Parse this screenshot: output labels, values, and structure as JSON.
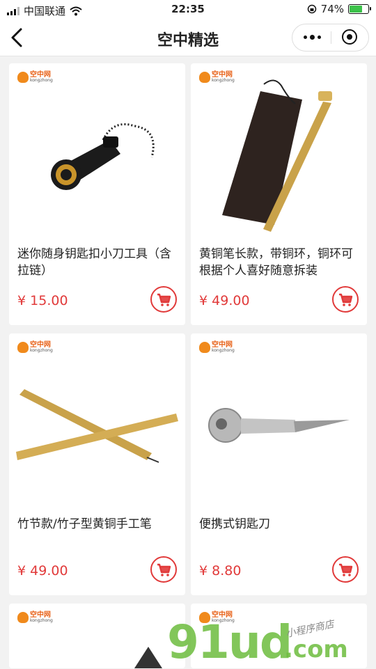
{
  "status_bar": {
    "carrier": "中国联通",
    "time": "22:35",
    "battery": "74%",
    "battery_level": 0.74
  },
  "nav": {
    "title": "空中精选"
  },
  "brand": {
    "cn": "空中网",
    "en": "kongzhong"
  },
  "currency": "¥",
  "products": [
    {
      "name": "迷你随身钥匙扣小刀工具（含拉链）",
      "price": "15.00",
      "image": "keychain-knife"
    },
    {
      "name": "黄铜笔长款，带铜环，铜环可根据个人喜好随意拆装",
      "price": "49.00",
      "image": "brass-pen-pouch"
    },
    {
      "name": "竹节款/竹子型黄铜手工笔",
      "price": "49.00",
      "image": "bamboo-brass-pens"
    },
    {
      "name": "便携式钥匙刀",
      "price": "8.80",
      "image": "key-knife"
    }
  ],
  "watermark": {
    "main": "91ud",
    "suffix": ".com",
    "tagline": "小程序商店"
  },
  "colors": {
    "accent": "#e13a3a",
    "brand_orange": "#f08a1c",
    "background": "#f2f2f2",
    "watermark_green": "#6dbd3e"
  }
}
